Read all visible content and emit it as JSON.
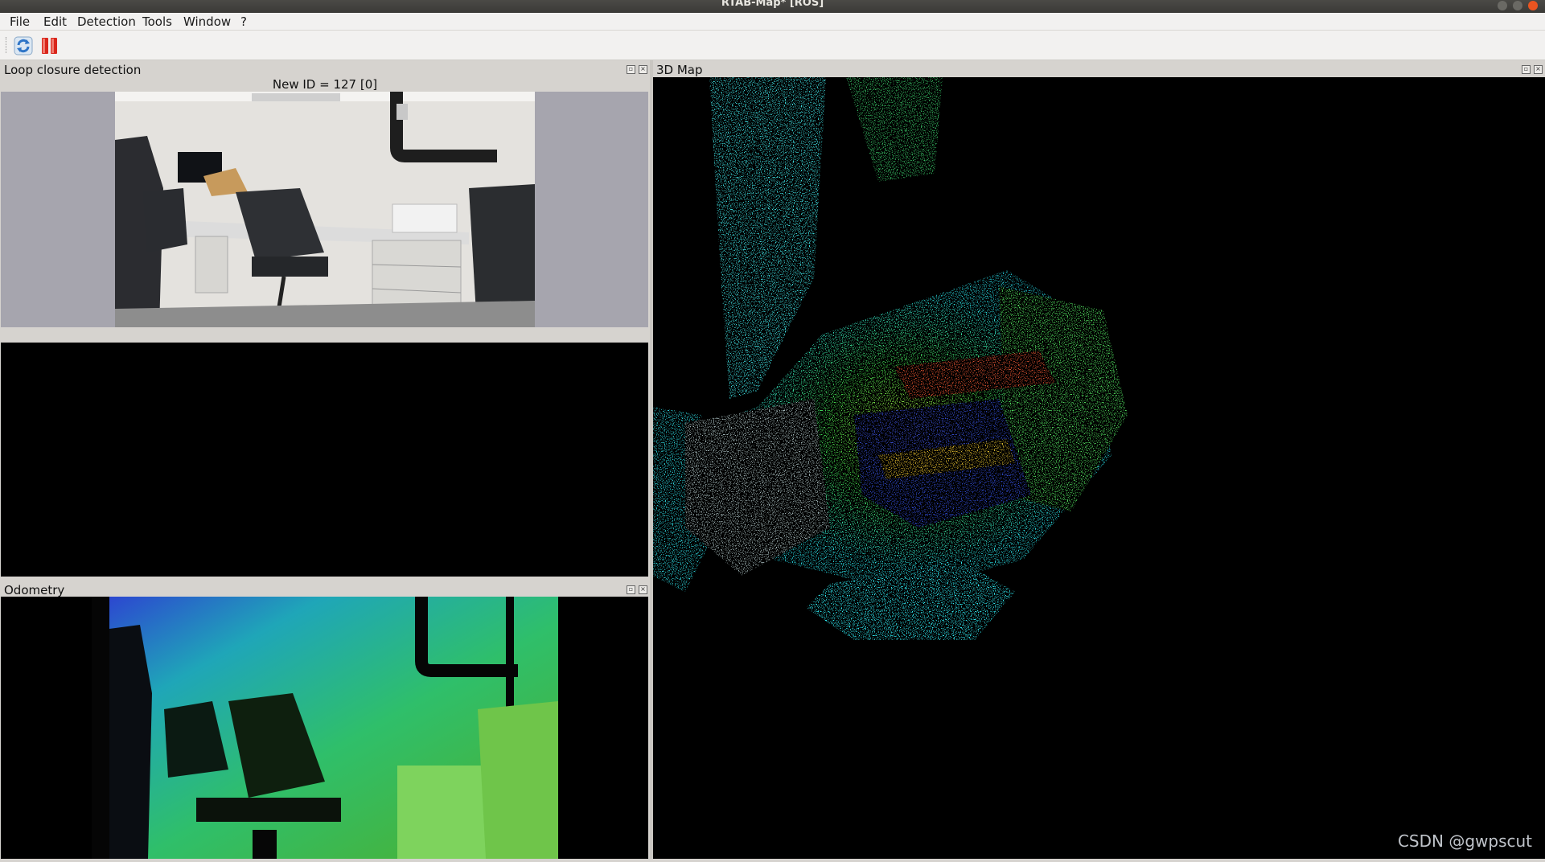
{
  "window": {
    "title": "RTAB-Map* [ROS]"
  },
  "menubar": {
    "items": [
      "File",
      "Edit",
      "Detection",
      "Tools",
      "Window",
      "?"
    ]
  },
  "toolbar": {
    "refresh_icon": "refresh-icon",
    "pause_icon": "pause-icon"
  },
  "loop_panel": {
    "title": "Loop closure detection",
    "new_id_label": "New ID = 127 [0]"
  },
  "odometry_panel": {
    "title": "Odometry"
  },
  "map_panel": {
    "title": "3D Map"
  },
  "watermark": "CSDN @gwpscut",
  "colors": {
    "titlebar": "#3b3a37",
    "close_button": "#e95420",
    "panel_bg": "#d6d3cf",
    "image_border": "#a6a5ae",
    "pointcloud_cyan": "#2ad8dc",
    "pointcloud_green": "#3fd04a",
    "pointcloud_blue": "#2233d8"
  }
}
